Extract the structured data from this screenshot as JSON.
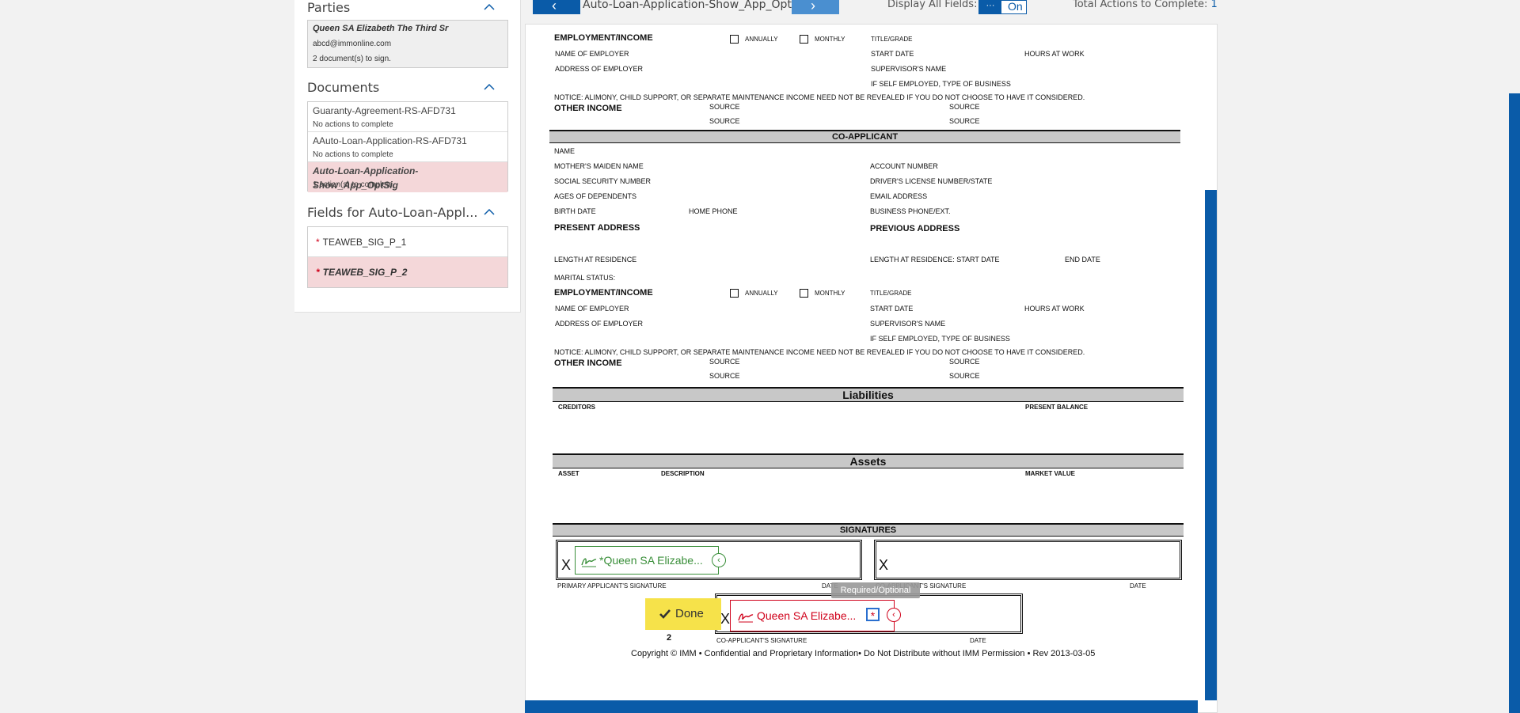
{
  "sidebar": {
    "parties": {
      "heading": "Parties",
      "name": "Queen SA Elizabeth The Third Sr",
      "email": "abcd@immonline.com",
      "docs_to_sign": "2 document(s) to sign."
    },
    "documents": {
      "heading": "Documents",
      "items": [
        {
          "name": "Guaranty-Agreement-RS-AFD731",
          "status": "No actions to complete"
        },
        {
          "name": "AAuto-Loan-Application-RS-AFD731",
          "status": "No actions to complete"
        },
        {
          "name": "Auto-Loan-Application-Show_App_OptSig",
          "status": "1 action(s) to complete"
        }
      ]
    },
    "fields": {
      "heading": "Fields for Auto-Loan-Appl...",
      "items": [
        {
          "star": "*",
          "name": "TEAWEB_SIG_P_1"
        },
        {
          "star": "*",
          "name": "TEAWEB_SIG_P_2"
        }
      ]
    }
  },
  "toolbar": {
    "prev_arrow": "‹",
    "next_arrow": "›",
    "doc_title": "Auto-Loan-Application-Show_App_OptSig",
    "display_all_label": "Display All Fields:",
    "toggle_dots": "···",
    "toggle_state": "On",
    "total_actions_label": "Total Actions to Complete:",
    "total_actions_value": "1"
  },
  "form": {
    "employment_income": "EMPLOYMENT/INCOME",
    "annually": "ANNUALLY",
    "monthly": "MONTHLY",
    "title_grade": "TITLE/GRADE",
    "name_of_employer": "NAME OF EMPLOYER",
    "start_date": "START DATE",
    "hours_at_work": "HOURS AT WORK",
    "address_of_employer": "ADDRESS OF EMPLOYER",
    "supervisors_name": "SUPERVISOR'S NAME",
    "self_employed": "IF SELF EMPLOYED, TYPE OF BUSINESS",
    "notice": "NOTICE: ALIMONY, CHILD SUPPORT, OR SEPARATE MAINTENANCE INCOME NEED NOT BE REVEALED IF YOU DO NOT CHOOSE TO HAVE IT CONSIDERED.",
    "other_income": "OTHER INCOME",
    "source": "SOURCE",
    "co_applicant": "CO-APPLICANT",
    "name": "NAME",
    "mothers_maiden": "MOTHER'S MAIDEN NAME",
    "account_number": "ACCOUNT NUMBER",
    "ssn": "SOCIAL SECURITY NUMBER",
    "drivers_license": "DRIVER'S LICENSE NUMBER/STATE",
    "ages_dependents": "AGES OF DEPENDENTS",
    "email_address": "EMAIL ADDRESS",
    "birth_date": "BIRTH DATE",
    "home_phone": "HOME PHONE",
    "business_phone": "BUSINESS PHONE/EXT.",
    "present_address": "PRESENT ADDRESS",
    "previous_address": "PREVIOUS ADDRESS",
    "length_residence": "LENGTH AT RESIDENCE",
    "length_residence_start": "LENGTH AT RESIDENCE:  START DATE",
    "end_date": "END DATE",
    "marital_status": "MARITAL STATUS:",
    "liabilities": "Liabilities",
    "creditors": "CREDITORS",
    "present_balance": "PRESENT BALANCE",
    "assets": "Assets",
    "asset": "ASSET",
    "description": "DESCRIPTION",
    "market_value": "MARKET VALUE",
    "signatures": "SIGNATURES",
    "x_mark": "X",
    "primary_sig": "PRIMARY APPLICANT'S SIGNATURE",
    "date": "DATE",
    "co_sig": "CO-APPLICANT'S SIGNATURE",
    "copyright": "Copyright © IMM • Confidential and Proprietary Information• Do Not Distribute without IMM Permission • Rev 2013-03-05"
  },
  "signing": {
    "green_sig_label": "*Queen SA Elizabe...",
    "red_sig_label": "Queen SA Elizabe...",
    "tooltip": "Required/Optional",
    "required_mark": "*",
    "done_label": "Done",
    "done_count": "2"
  },
  "colors": {
    "primary_blue": "#0a5ba8",
    "required_red": "#d0021b",
    "signed_green": "#3a8f3a",
    "done_yellow": "#f6e24a",
    "active_row_pink": "#f4d7d9"
  }
}
